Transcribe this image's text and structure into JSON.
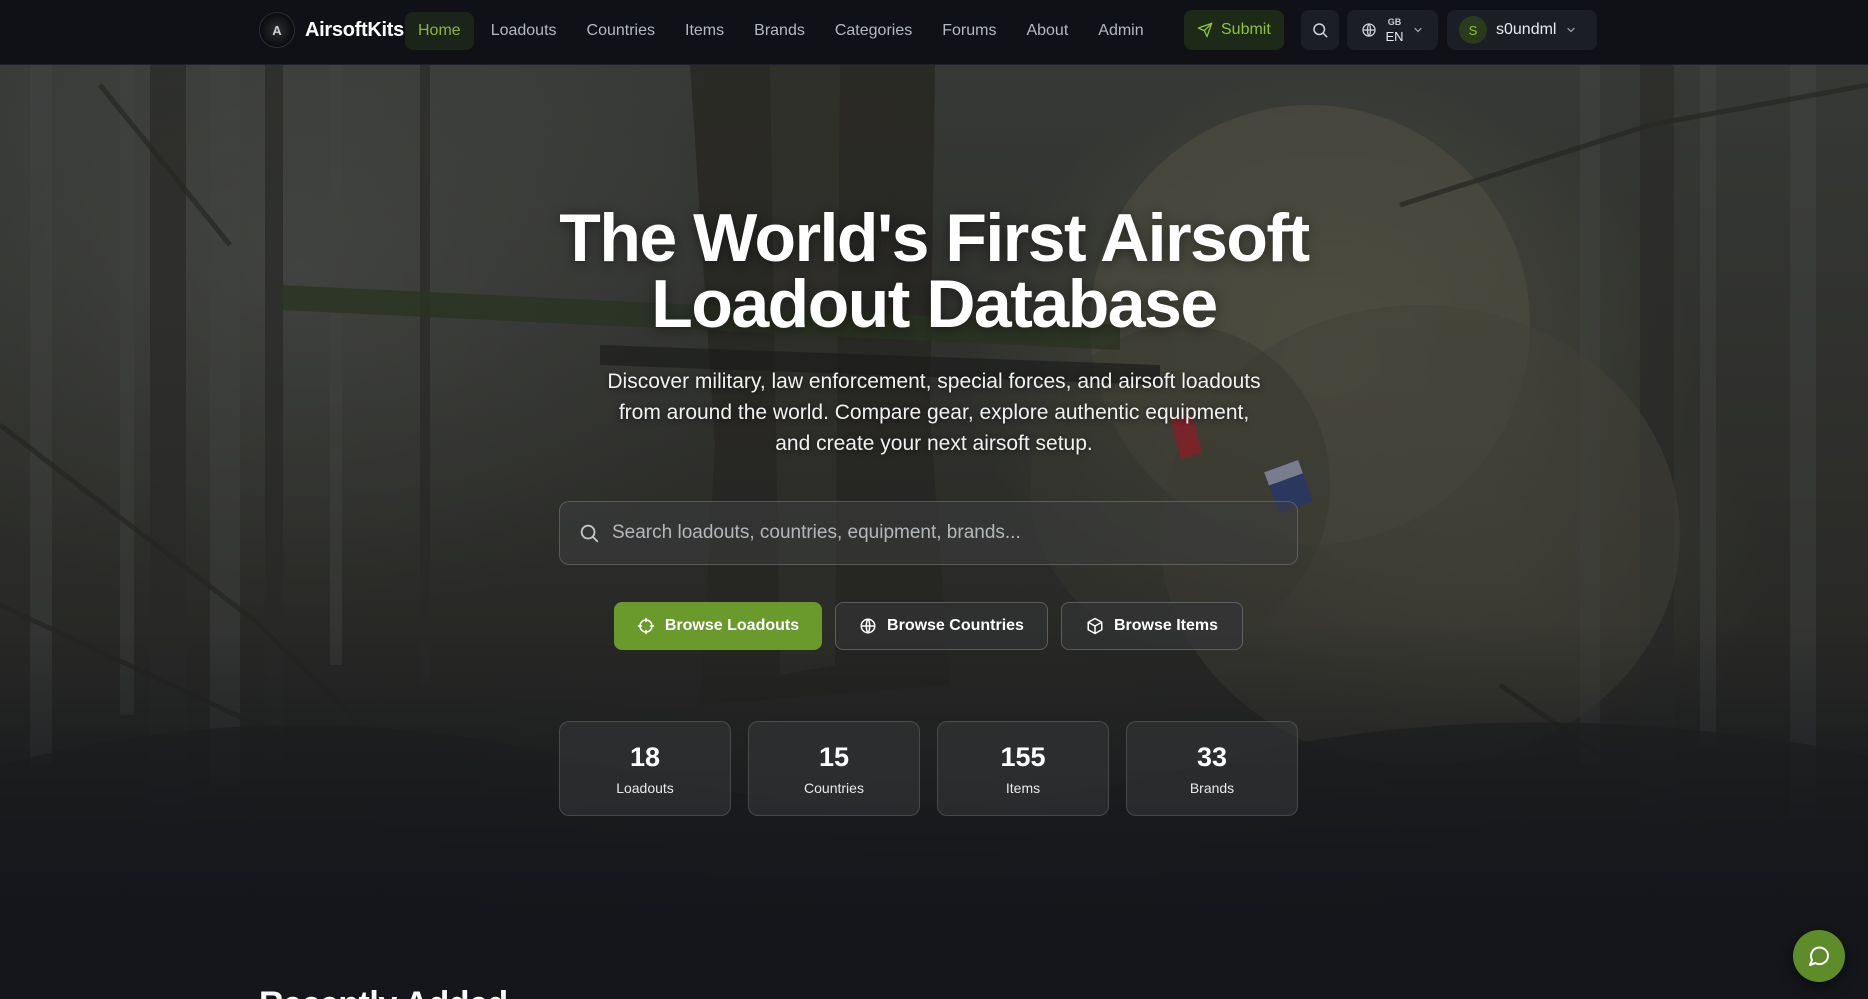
{
  "brand": {
    "name": "AirsoftKits",
    "logo_text": "A"
  },
  "nav": {
    "links": [
      {
        "label": "Home",
        "active": true
      },
      {
        "label": "Loadouts"
      },
      {
        "label": "Countries"
      },
      {
        "label": "Items"
      },
      {
        "label": "Brands"
      },
      {
        "label": "Categories"
      },
      {
        "label": "Forums"
      },
      {
        "label": "About"
      },
      {
        "label": "Admin"
      }
    ],
    "submit_label": "Submit",
    "language": {
      "flag": "GB",
      "code": "EN"
    },
    "user": {
      "initial": "S",
      "name": "s0undml"
    }
  },
  "hero": {
    "title_line1": "The World's First Airsoft",
    "title_line2": "Loadout Database",
    "subtitle_line1": "Discover military, law enforcement, special forces, and airsoft loadouts",
    "subtitle_line2": "from around the world. Compare gear, explore authentic equipment,",
    "subtitle_line3": "and create your next airsoft setup.",
    "search_placeholder": "Search loadouts, countries, equipment, brands...",
    "buttons": {
      "loadouts": "Browse Loadouts",
      "countries": "Browse Countries",
      "items": "Browse Items"
    },
    "stats": [
      {
        "value": "18",
        "label": "Loadouts"
      },
      {
        "value": "15",
        "label": "Countries"
      },
      {
        "value": "155",
        "label": "Items"
      },
      {
        "value": "33",
        "label": "Brands"
      }
    ]
  },
  "section_peek": "Recently Added",
  "colors": {
    "accent": "#6b9a2c",
    "accent_text": "#8cc43a",
    "navbar_bg": "#0f1117"
  },
  "icons": {
    "search": "search-icon",
    "globe": "globe-icon",
    "send": "send-icon",
    "crosshair": "crosshair-icon",
    "box": "box-icon",
    "chat": "chat-icon",
    "chevron": "chevron-down-icon"
  }
}
